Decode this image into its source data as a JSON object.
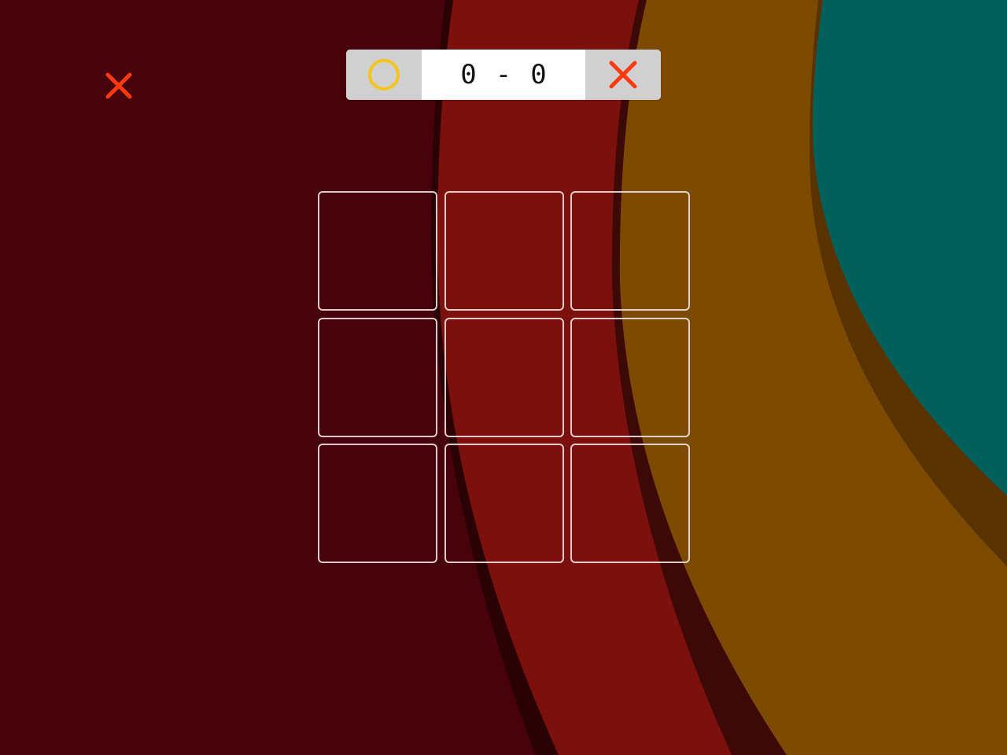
{
  "colors": {
    "background_dark_red": "#48020b",
    "band_red": "#7c100d",
    "band_orange": "#7d4a02",
    "band_teal": "#00605c",
    "x_mark": "#ff3a0e",
    "o_mark": "#f3c51b",
    "scoreboard_caps": "#d0d0d0",
    "scoreboard_center": "#ffffff",
    "cell_border": "#ece2e2"
  },
  "turn_indicator": {
    "player": "X",
    "icon": "x-mark-icon"
  },
  "scoreboard": {
    "left_player_icon": "o-circle-icon",
    "right_player_icon": "x-mark-icon",
    "o_score": "0",
    "separator": "-",
    "x_score": "0"
  },
  "board": {
    "rows": 3,
    "cols": 3,
    "cells": [
      "",
      "",
      "",
      "",
      "",
      "",
      "",
      "",
      ""
    ]
  }
}
